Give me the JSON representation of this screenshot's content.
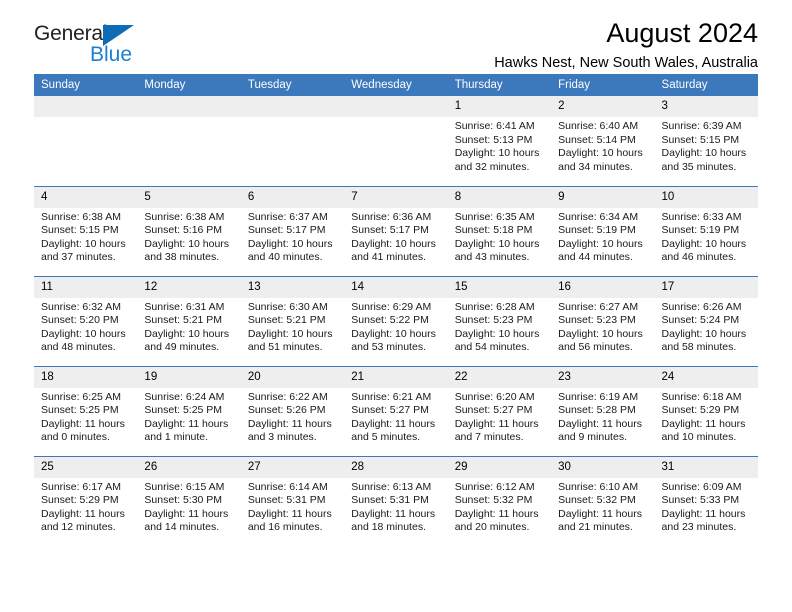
{
  "brand": {
    "name_top": "General",
    "name_bottom": "Blue",
    "triangle_color": "#0d6cb4",
    "blue_color": "#1b7fd4"
  },
  "header": {
    "title": "August 2024",
    "subtitle": "Hawks Nest, New South Wales, Australia"
  },
  "theme": {
    "header_bg": "#3b78bc",
    "daynum_bg": "#eeeeee",
    "grid_line": "#3b78bc"
  },
  "weekdays": [
    "Sunday",
    "Monday",
    "Tuesday",
    "Wednesday",
    "Thursday",
    "Friday",
    "Saturday"
  ],
  "labels": {
    "sunrise_prefix": "Sunrise:",
    "sunset_prefix": "Sunset:",
    "daylight_prefix": "Daylight:"
  },
  "weeks": [
    [
      {
        "empty": true
      },
      {
        "empty": true
      },
      {
        "empty": true
      },
      {
        "empty": true
      },
      {
        "day": "1",
        "sunrise": "Sunrise: 6:41 AM",
        "sunset": "Sunset: 5:13 PM",
        "daylight_line1": "Daylight: 10 hours",
        "daylight_line2": "and 32 minutes."
      },
      {
        "day": "2",
        "sunrise": "Sunrise: 6:40 AM",
        "sunset": "Sunset: 5:14 PM",
        "daylight_line1": "Daylight: 10 hours",
        "daylight_line2": "and 34 minutes."
      },
      {
        "day": "3",
        "sunrise": "Sunrise: 6:39 AM",
        "sunset": "Sunset: 5:15 PM",
        "daylight_line1": "Daylight: 10 hours",
        "daylight_line2": "and 35 minutes."
      }
    ],
    [
      {
        "day": "4",
        "sunrise": "Sunrise: 6:38 AM",
        "sunset": "Sunset: 5:15 PM",
        "daylight_line1": "Daylight: 10 hours",
        "daylight_line2": "and 37 minutes."
      },
      {
        "day": "5",
        "sunrise": "Sunrise: 6:38 AM",
        "sunset": "Sunset: 5:16 PM",
        "daylight_line1": "Daylight: 10 hours",
        "daylight_line2": "and 38 minutes."
      },
      {
        "day": "6",
        "sunrise": "Sunrise: 6:37 AM",
        "sunset": "Sunset: 5:17 PM",
        "daylight_line1": "Daylight: 10 hours",
        "daylight_line2": "and 40 minutes."
      },
      {
        "day": "7",
        "sunrise": "Sunrise: 6:36 AM",
        "sunset": "Sunset: 5:17 PM",
        "daylight_line1": "Daylight: 10 hours",
        "daylight_line2": "and 41 minutes."
      },
      {
        "day": "8",
        "sunrise": "Sunrise: 6:35 AM",
        "sunset": "Sunset: 5:18 PM",
        "daylight_line1": "Daylight: 10 hours",
        "daylight_line2": "and 43 minutes."
      },
      {
        "day": "9",
        "sunrise": "Sunrise: 6:34 AM",
        "sunset": "Sunset: 5:19 PM",
        "daylight_line1": "Daylight: 10 hours",
        "daylight_line2": "and 44 minutes."
      },
      {
        "day": "10",
        "sunrise": "Sunrise: 6:33 AM",
        "sunset": "Sunset: 5:19 PM",
        "daylight_line1": "Daylight: 10 hours",
        "daylight_line2": "and 46 minutes."
      }
    ],
    [
      {
        "day": "11",
        "sunrise": "Sunrise: 6:32 AM",
        "sunset": "Sunset: 5:20 PM",
        "daylight_line1": "Daylight: 10 hours",
        "daylight_line2": "and 48 minutes."
      },
      {
        "day": "12",
        "sunrise": "Sunrise: 6:31 AM",
        "sunset": "Sunset: 5:21 PM",
        "daylight_line1": "Daylight: 10 hours",
        "daylight_line2": "and 49 minutes."
      },
      {
        "day": "13",
        "sunrise": "Sunrise: 6:30 AM",
        "sunset": "Sunset: 5:21 PM",
        "daylight_line1": "Daylight: 10 hours",
        "daylight_line2": "and 51 minutes."
      },
      {
        "day": "14",
        "sunrise": "Sunrise: 6:29 AM",
        "sunset": "Sunset: 5:22 PM",
        "daylight_line1": "Daylight: 10 hours",
        "daylight_line2": "and 53 minutes."
      },
      {
        "day": "15",
        "sunrise": "Sunrise: 6:28 AM",
        "sunset": "Sunset: 5:23 PM",
        "daylight_line1": "Daylight: 10 hours",
        "daylight_line2": "and 54 minutes."
      },
      {
        "day": "16",
        "sunrise": "Sunrise: 6:27 AM",
        "sunset": "Sunset: 5:23 PM",
        "daylight_line1": "Daylight: 10 hours",
        "daylight_line2": "and 56 minutes."
      },
      {
        "day": "17",
        "sunrise": "Sunrise: 6:26 AM",
        "sunset": "Sunset: 5:24 PM",
        "daylight_line1": "Daylight: 10 hours",
        "daylight_line2": "and 58 minutes."
      }
    ],
    [
      {
        "day": "18",
        "sunrise": "Sunrise: 6:25 AM",
        "sunset": "Sunset: 5:25 PM",
        "daylight_line1": "Daylight: 11 hours",
        "daylight_line2": "and 0 minutes."
      },
      {
        "day": "19",
        "sunrise": "Sunrise: 6:24 AM",
        "sunset": "Sunset: 5:25 PM",
        "daylight_line1": "Daylight: 11 hours",
        "daylight_line2": "and 1 minute."
      },
      {
        "day": "20",
        "sunrise": "Sunrise: 6:22 AM",
        "sunset": "Sunset: 5:26 PM",
        "daylight_line1": "Daylight: 11 hours",
        "daylight_line2": "and 3 minutes."
      },
      {
        "day": "21",
        "sunrise": "Sunrise: 6:21 AM",
        "sunset": "Sunset: 5:27 PM",
        "daylight_line1": "Daylight: 11 hours",
        "daylight_line2": "and 5 minutes."
      },
      {
        "day": "22",
        "sunrise": "Sunrise: 6:20 AM",
        "sunset": "Sunset: 5:27 PM",
        "daylight_line1": "Daylight: 11 hours",
        "daylight_line2": "and 7 minutes."
      },
      {
        "day": "23",
        "sunrise": "Sunrise: 6:19 AM",
        "sunset": "Sunset: 5:28 PM",
        "daylight_line1": "Daylight: 11 hours",
        "daylight_line2": "and 9 minutes."
      },
      {
        "day": "24",
        "sunrise": "Sunrise: 6:18 AM",
        "sunset": "Sunset: 5:29 PM",
        "daylight_line1": "Daylight: 11 hours",
        "daylight_line2": "and 10 minutes."
      }
    ],
    [
      {
        "day": "25",
        "sunrise": "Sunrise: 6:17 AM",
        "sunset": "Sunset: 5:29 PM",
        "daylight_line1": "Daylight: 11 hours",
        "daylight_line2": "and 12 minutes."
      },
      {
        "day": "26",
        "sunrise": "Sunrise: 6:15 AM",
        "sunset": "Sunset: 5:30 PM",
        "daylight_line1": "Daylight: 11 hours",
        "daylight_line2": "and 14 minutes."
      },
      {
        "day": "27",
        "sunrise": "Sunrise: 6:14 AM",
        "sunset": "Sunset: 5:31 PM",
        "daylight_line1": "Daylight: 11 hours",
        "daylight_line2": "and 16 minutes."
      },
      {
        "day": "28",
        "sunrise": "Sunrise: 6:13 AM",
        "sunset": "Sunset: 5:31 PM",
        "daylight_line1": "Daylight: 11 hours",
        "daylight_line2": "and 18 minutes."
      },
      {
        "day": "29",
        "sunrise": "Sunrise: 6:12 AM",
        "sunset": "Sunset: 5:32 PM",
        "daylight_line1": "Daylight: 11 hours",
        "daylight_line2": "and 20 minutes."
      },
      {
        "day": "30",
        "sunrise": "Sunrise: 6:10 AM",
        "sunset": "Sunset: 5:32 PM",
        "daylight_line1": "Daylight: 11 hours",
        "daylight_line2": "and 21 minutes."
      },
      {
        "day": "31",
        "sunrise": "Sunrise: 6:09 AM",
        "sunset": "Sunset: 5:33 PM",
        "daylight_line1": "Daylight: 11 hours",
        "daylight_line2": "and 23 minutes."
      }
    ]
  ]
}
